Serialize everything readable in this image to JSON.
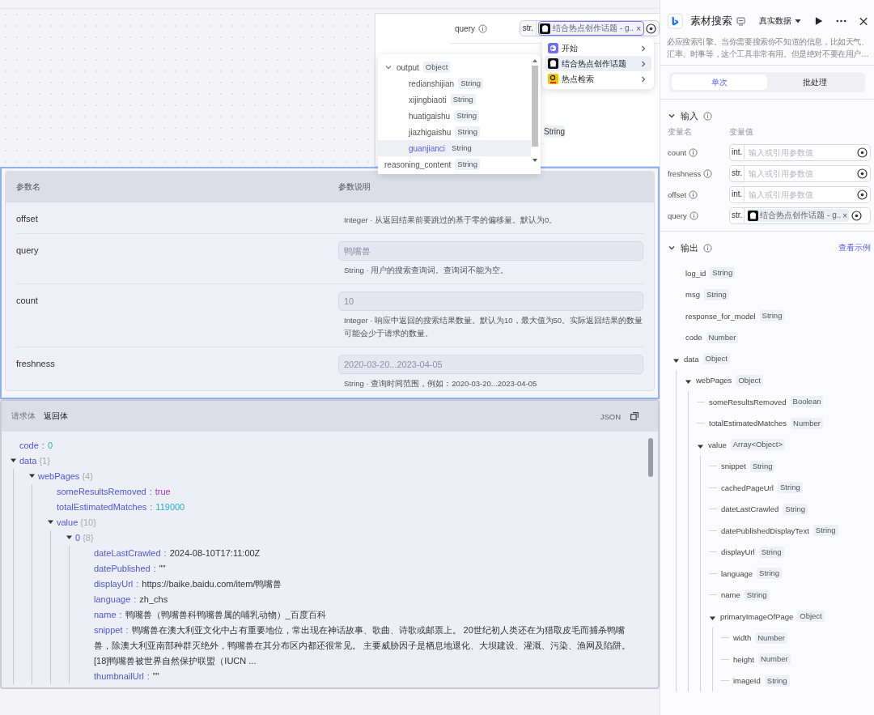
{
  "node_card": {
    "label": "query",
    "type_tag": "str.",
    "reference": "结合热点创作话题 - g..",
    "remove": "×",
    "output_type": "String"
  },
  "source_menu": [
    {
      "label": "开始",
      "kind": "start",
      "selected": false
    },
    {
      "label": "结合热点创作话题",
      "kind": "bot",
      "selected": true
    },
    {
      "label": "热点检索",
      "kind": "search",
      "selected": false
    }
  ],
  "variable_menu": [
    {
      "name": "output",
      "type": "Object",
      "expanded": true,
      "selected": false,
      "children": [
        {
          "name": "redianshijian",
          "type": "String",
          "selected": false
        },
        {
          "name": "xijingbiaoti",
          "type": "String",
          "selected": false
        },
        {
          "name": "huatigaishu",
          "type": "String",
          "selected": false
        },
        {
          "name": "jiazhigaishu",
          "type": "String",
          "selected": false
        },
        {
          "name": "guanjianci",
          "type": "String",
          "selected": true
        }
      ]
    },
    {
      "name": "reasoning_content",
      "type": "String",
      "selected": false
    }
  ],
  "params_table": {
    "columns": [
      "参数名",
      "参数说明"
    ],
    "rows": [
      {
        "name": "offset",
        "description": "Integer · 从返回结果前要跳过的基于零的偏移量。默认为0。"
      },
      {
        "name": "query",
        "placeholder": "鸭嘴兽",
        "description": "String · 用户的搜索查询词。查询词不能为空。"
      },
      {
        "name": "count",
        "placeholder": "10",
        "description": "Integer · 响应中返回的搜索结果数量。默认为10，最大值为50。实际返回结果的数量可能会少于请求的数量。"
      },
      {
        "name": "freshness",
        "placeholder": "2020-03-20...2023-04-05",
        "description": "String · 查询时间范围，例如：2020-03-20...2023-04-05"
      }
    ]
  },
  "response_panel": {
    "separator": ":",
    "tabs": [
      {
        "label": "请求体",
        "selected": false
      },
      {
        "label": "返回体",
        "selected": true
      }
    ],
    "format": "JSON",
    "tree": [
      {
        "key": "code",
        "value": "0",
        "kind": "number"
      },
      {
        "key": "data",
        "count": "{1}",
        "expanded": true,
        "children": [
          {
            "key": "webPages",
            "count": "{4}",
            "expanded": true,
            "children": [
              {
                "key": "someResultsRemoved",
                "value": "true",
                "kind": "boolean"
              },
              {
                "key": "totalEstimatedMatches",
                "value": "119000",
                "kind": "number"
              },
              {
                "key": "value",
                "count": "{10}",
                "expanded": true,
                "children": [
                  {
                    "key": "0",
                    "count": "{8}",
                    "expanded": true,
                    "children": [
                      {
                        "key": "dateLastCrawled",
                        "value": "2024-08-10T17:11:00Z",
                        "kind": "string"
                      },
                      {
                        "key": "datePublished",
                        "value": "\"\"",
                        "kind": "string"
                      },
                      {
                        "key": "displayUrl",
                        "value": "https://baike.baidu.com/item/鸭嘴兽",
                        "kind": "string"
                      },
                      {
                        "key": "language",
                        "value": "zh_chs",
                        "kind": "string"
                      },
                      {
                        "key": "name",
                        "value": "鸭嘴兽（鸭嘴兽科鸭嘴兽属的哺乳动物）_百度百科",
                        "kind": "string"
                      },
                      {
                        "key": "snippet",
                        "value": "鸭嘴兽在澳大利亚文化中占有重要地位，常出现在神话故事、歌曲、诗歌或邮票上。 20世纪初人类还在为猎取皮毛而捕杀鸭嘴兽，除澳大利亚南部种群灭绝外，鸭嘴兽在其分布区内都还很常见。 主要威胁因子是栖息地退化、大坝建设、灌溉、污染、渔网及陷阱。[18]鸭嘴兽被世界自然保护联盟（IUCN ...",
                        "kind": "string"
                      },
                      {
                        "key": "thumbnailUrl",
                        "value": "\"\"",
                        "kind": "string"
                      }
                    ]
                  }
                ]
              }
            ]
          }
        ]
      }
    ]
  },
  "side_panel": {
    "title": "素材搜索",
    "data_mode": "真实数据",
    "description": "必应搜索引擎。当你需要搜索你不知道的信息，比如天气、汇率、时事等，这个工具非常有用。但是绝对不要在用户…",
    "mode_tabs": [
      {
        "label": "单次",
        "selected": true
      },
      {
        "label": "批处理",
        "selected": false
      }
    ],
    "input": {
      "title": "输入",
      "columns": [
        "变量名",
        "变量值"
      ],
      "variables": [
        {
          "name": "count",
          "type": "int.",
          "placeholder": "输入或引用参数值"
        },
        {
          "name": "freshness",
          "type": "str.",
          "placeholder": "输入或引用参数值"
        },
        {
          "name": "offset",
          "type": "int.",
          "placeholder": "输入或引用参数值"
        },
        {
          "name": "query",
          "type": "str.",
          "reference": "结合热点创作话题 - g..",
          "remove": "×"
        }
      ]
    },
    "output": {
      "title": "输出",
      "link": "查看示例",
      "tree": [
        {
          "name": "log_id",
          "type": "String"
        },
        {
          "name": "msg",
          "type": "String"
        },
        {
          "name": "response_for_model",
          "type": "String"
        },
        {
          "name": "code",
          "type": "Number"
        },
        {
          "name": "data",
          "type": "Object",
          "expanded": true,
          "children": [
            {
              "name": "webPages",
              "type": "Object",
              "expanded": true,
              "children": [
                {
                  "name": "someResultsRemoved",
                  "type": "Boolean"
                },
                {
                  "name": "totalEstimatedMatches",
                  "type": "Number"
                },
                {
                  "name": "value",
                  "type": "Array<Object>",
                  "expanded": true,
                  "children": [
                    {
                      "name": "snippet",
                      "type": "String"
                    },
                    {
                      "name": "cachedPageUrl",
                      "type": "String"
                    },
                    {
                      "name": "dateLastCrawled",
                      "type": "String"
                    },
                    {
                      "name": "datePublishedDisplayText",
                      "type": "String"
                    },
                    {
                      "name": "displayUrl",
                      "type": "String"
                    },
                    {
                      "name": "language",
                      "type": "String"
                    },
                    {
                      "name": "name",
                      "type": "String"
                    },
                    {
                      "name": "primaryImageOfPage",
                      "type": "Object",
                      "expanded": true,
                      "children": [
                        {
                          "name": "width",
                          "type": "Number"
                        },
                        {
                          "name": "height",
                          "type": "Number"
                        },
                        {
                          "name": "imageId",
                          "type": "String"
                        }
                      ]
                    }
                  ]
                }
              ]
            }
          ]
        }
      ]
    }
  }
}
